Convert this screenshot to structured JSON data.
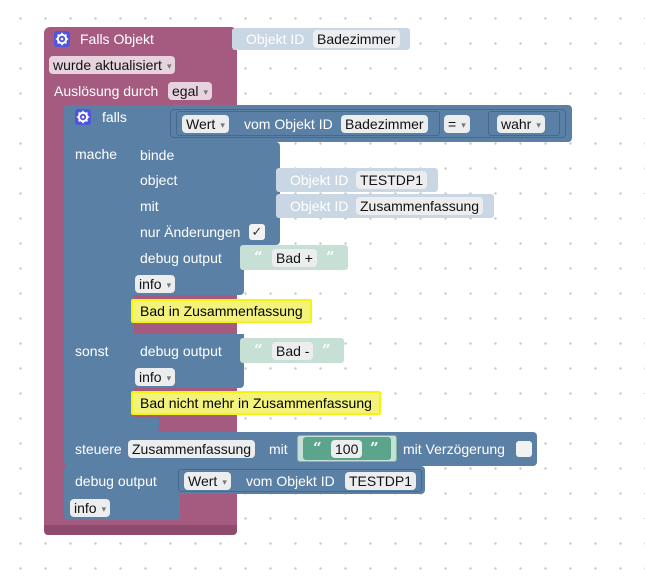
{
  "trigger": {
    "title": "Falls Objekt",
    "object_id_label": "Objekt ID",
    "object_id_value": "Badezimmer",
    "event_value": "wurde aktualisiert",
    "cause_label": "Auslösung durch",
    "cause_value": "egal"
  },
  "if_block": {
    "if_label": "falls",
    "value_dropdown": "Wert",
    "from_object_label": "vom Objekt ID",
    "object_value": "Badezimmer",
    "operator": "=",
    "compare_value": "wahr",
    "do_label": "mache",
    "else_label": "sonst"
  },
  "bind_block": {
    "title": "binde",
    "object_label": "object",
    "object_id_label": "Objekt ID",
    "object_value": "TESTDP1",
    "with_label": "mit",
    "with_id_label": "Objekt ID",
    "with_value": "Zusammenfassung",
    "only_changes_label": "nur Änderungen",
    "only_changes_checked": "✓"
  },
  "debug_then": {
    "label": "debug output",
    "text": "Bad +",
    "level": "info",
    "comment": "Bad in Zusammenfassung"
  },
  "debug_else": {
    "label": "debug output",
    "text": "Bad -",
    "level": "info",
    "comment": "Bad nicht mehr in Zusammenfassung"
  },
  "control_block": {
    "label": "steuere",
    "target": "Zusammenfassung",
    "with_label": "mit",
    "value": "100",
    "delay_label": "mit Verzögerung"
  },
  "debug_final": {
    "label": "debug output",
    "value_dropdown": "Wert",
    "from_object_label": "vom Objekt ID",
    "object_value": "TESTDP1",
    "level": "info"
  },
  "colors": {
    "trigger_block": "#a55b80",
    "logic_block": "#5b80a5",
    "value_block": "#c9d7e5",
    "text_block": "#c6e0d6",
    "comment_highlight": "#f4f40c",
    "gear_icon": "#4f55dd"
  }
}
